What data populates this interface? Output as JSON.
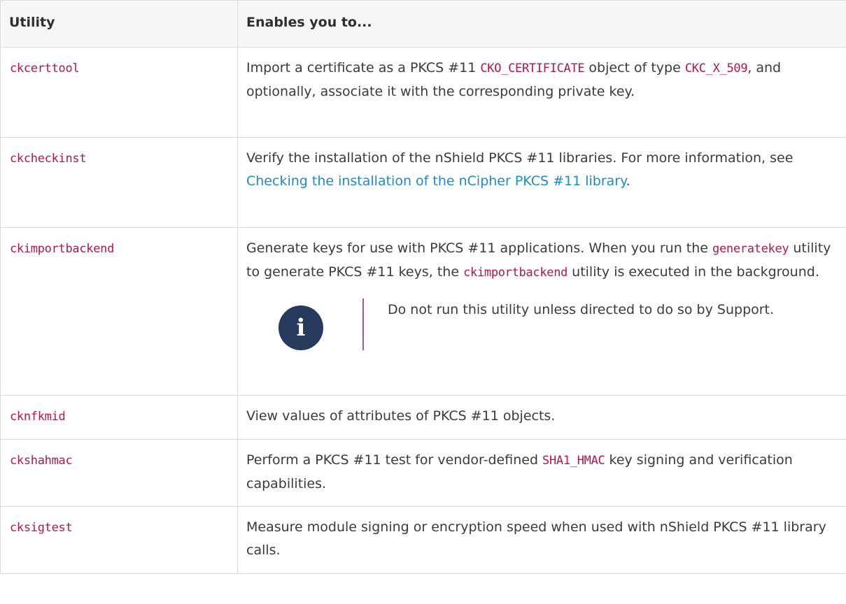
{
  "table": {
    "headers": [
      "Utility",
      "Enables you to..."
    ],
    "rows": [
      {
        "utility": "ckcerttool",
        "desc": {
          "t1": "Import a certificate as a PKCS #11 ",
          "c1": "CKO_CERTIFICATE",
          "t2": " object of type ",
          "c2": "CKC_X_509",
          "t3": ", and optionally, associate it with the corresponding private key."
        }
      },
      {
        "utility": "ckcheckinst",
        "desc": {
          "t1": "Verify the installation of the nShield PKCS #11 libraries. For more information, see ",
          "link": "Checking the installation of the nCipher PKCS #11 library",
          "t2": "."
        }
      },
      {
        "utility": "ckimportbackend",
        "desc": {
          "t1": "Generate keys for use with PKCS #11 applications. When you run the ",
          "c1": "generatekey",
          "t2": " utility to generate PKCS #11 keys, the ",
          "c2": "ckimportbackend",
          "t3": " utility is executed in the background."
        },
        "note": {
          "icon": "info-icon",
          "glyph": "i",
          "text": "Do not run this utility unless directed to do so by Support."
        }
      },
      {
        "utility": "cknfkmid",
        "desc": {
          "t1": "View values of attributes of PKCS #11 objects."
        }
      },
      {
        "utility": "ckshahmac",
        "desc": {
          "t1": "Perform a PKCS #11 test for vendor-defined ",
          "c1": "SHA1_HMAC",
          "t2": " key signing and verification capabilities."
        }
      },
      {
        "utility": "cksigtest",
        "desc": {
          "t1": "Measure module signing or encryption speed when used with nShield PKCS #11 library calls."
        }
      }
    ]
  },
  "colors": {
    "code": "#b1174b",
    "link": "#1c8bc7",
    "header_bg": "#f7f7f8",
    "note_icon": "#263a5e",
    "note_bar": "#9a5a9a"
  }
}
